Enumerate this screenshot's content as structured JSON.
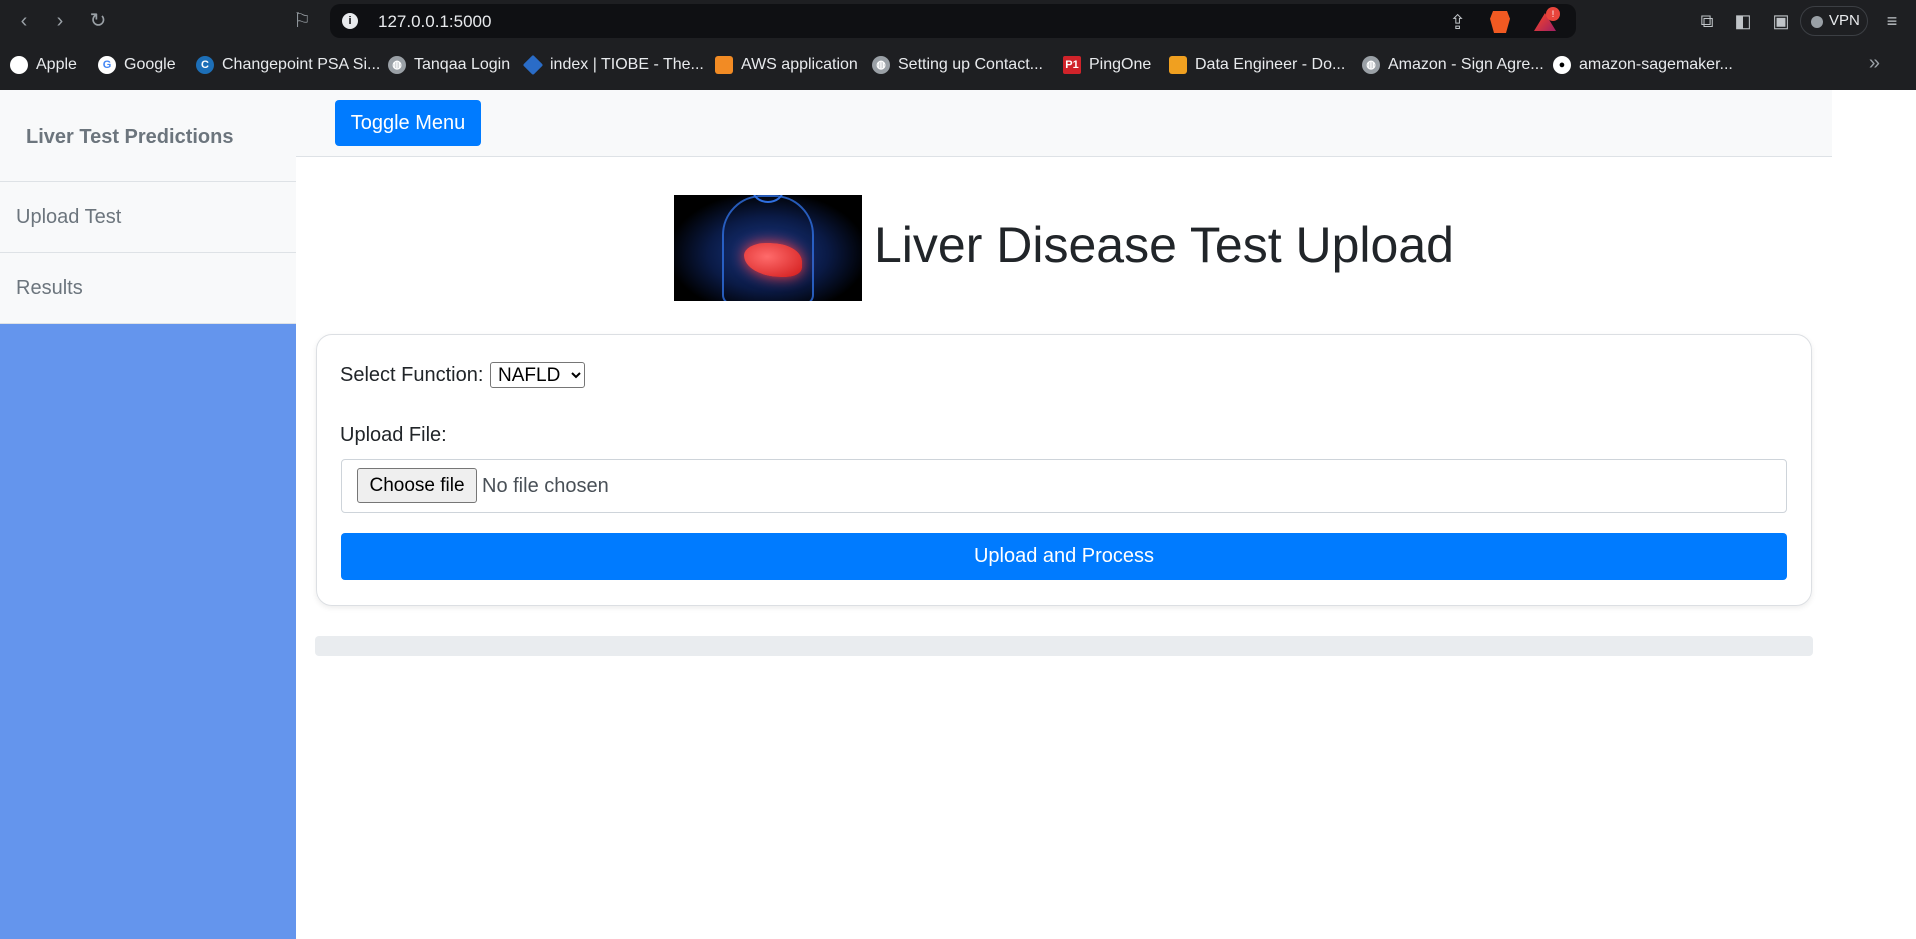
{
  "browser": {
    "url": "127.0.0.1:5000",
    "vpn_label": "VPN",
    "rewards_badge": "!",
    "bookmarks": [
      {
        "label": "Apple",
        "icon": "apple-icon"
      },
      {
        "label": "Google",
        "icon": "google-icon"
      },
      {
        "label": "Changepoint PSA Si...",
        "icon": "changepoint-icon"
      },
      {
        "label": "Tanqaa Login",
        "icon": "globe-icon"
      },
      {
        "label": "index | TIOBE - The...",
        "icon": "tiobe-icon"
      },
      {
        "label": "AWS application",
        "icon": "aws-icon"
      },
      {
        "label": "Setting up Contact...",
        "icon": "globe-icon"
      },
      {
        "label": "PingOne",
        "icon": "pingone-icon"
      },
      {
        "label": "Data Engineer - Do...",
        "icon": "hex-icon"
      },
      {
        "label": "Amazon - Sign Agre...",
        "icon": "globe-icon"
      },
      {
        "label": "amazon-sagemaker...",
        "icon": "github-icon"
      }
    ]
  },
  "sidebar": {
    "title": "Liver Test Predictions",
    "items": [
      {
        "label": "Upload Test"
      },
      {
        "label": "Results"
      }
    ]
  },
  "navbar": {
    "toggle_label": "Toggle Menu"
  },
  "main": {
    "title": "Liver Disease Test Upload",
    "hero_image": "liver-anatomy-image",
    "form": {
      "function_label": "Select Function:",
      "function_selected": "NAFLD",
      "file_label": "Upload File:",
      "choose_file_label": "Choose file",
      "file_status": "No file chosen",
      "submit_label": "Upload and Process"
    },
    "progress": 0
  },
  "colors": {
    "sidebar_bg": "#6495ed",
    "primary": "#007bff",
    "chrome_bg": "#1e1f22"
  }
}
